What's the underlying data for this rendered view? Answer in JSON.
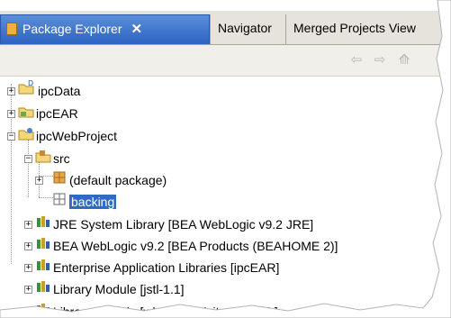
{
  "tabs": [
    {
      "label": "Package Explorer",
      "close": "✕"
    },
    {
      "label": "Navigator"
    },
    {
      "label": "Merged Projects View"
    }
  ],
  "toolbar": {
    "back_icon": "back-arrow-icon",
    "forward_icon": "forward-arrow-icon",
    "up_icon": "up-folder-icon"
  },
  "tree": [
    {
      "label": "ipcData"
    },
    {
      "label": "ipcEAR"
    },
    {
      "label": "ipcWebProject"
    },
    {
      "label": "src"
    },
    {
      "label": "(default package)"
    },
    {
      "label": "backing"
    },
    {
      "label": "JRE System Library [BEA WebLogic v9.2 JRE]"
    },
    {
      "label": "BEA WebLogic v9.2 [BEA Products (BEAHOME 2)]"
    },
    {
      "label": "Enterprise Application Libraries [ipcEAR]"
    },
    {
      "label": "Library Module [jstl-1.1]"
    },
    {
      "label": "Library Module [wlp-tools-visitor-web-lib]"
    }
  ],
  "colors": {
    "selection": "#316ac5",
    "active_tab": "#2d62c2",
    "library_icon": "#c9a21a"
  }
}
